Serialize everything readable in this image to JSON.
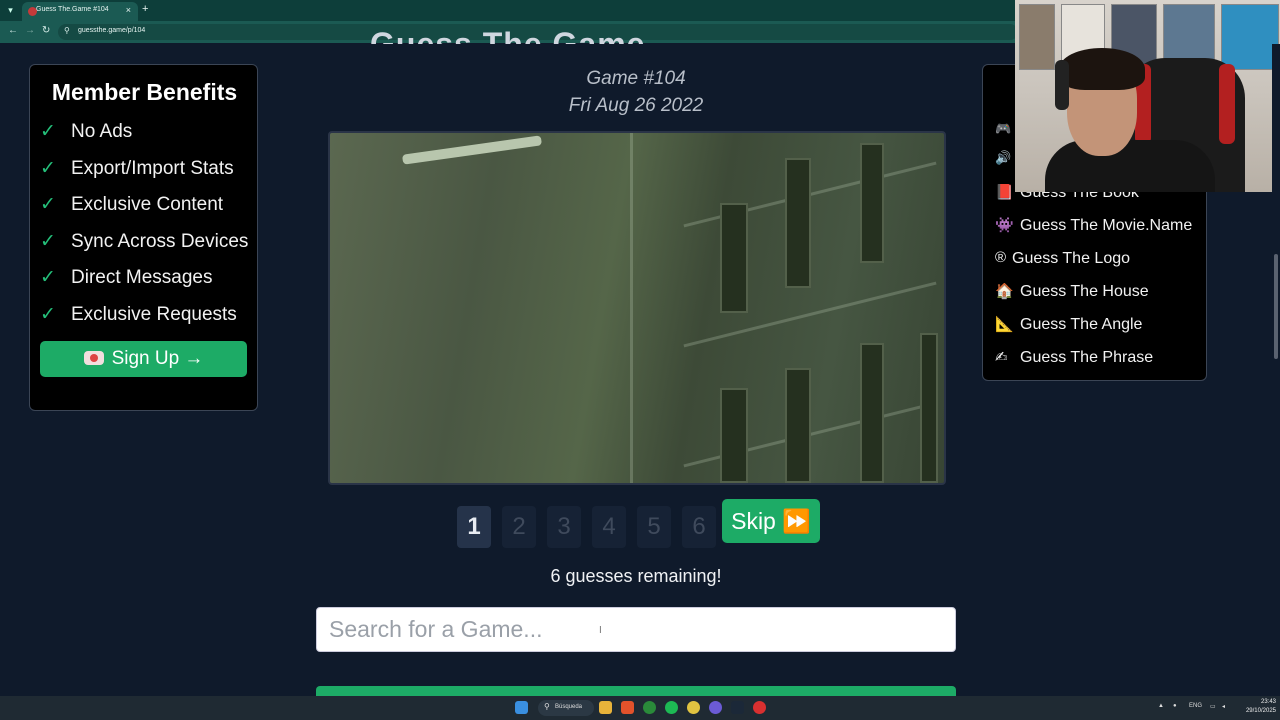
{
  "browser": {
    "tab_title": "Guess The.Game #104",
    "url": "guessthe.game/p/104"
  },
  "header": {
    "site_title": "Guess The.Game",
    "game_number": "Game #104",
    "game_date": "Fri Aug 26 2022"
  },
  "benefits": {
    "title": "Member Benefits",
    "check": "✓",
    "items": [
      "No Ads",
      "Export/Import Stats",
      "Exclusive Content",
      "Sync Across Devices",
      "Direct Messages",
      "Exclusive Requests"
    ],
    "signup_label": "Sign Up →"
  },
  "guesses": {
    "numbers": [
      "1",
      "2",
      "3",
      "4",
      "5",
      "6"
    ],
    "active": 1,
    "skip_label": "Skip ⏩",
    "remaining_text": "6 guesses remaining!"
  },
  "search": {
    "placeholder": "Search for a Game..."
  },
  "other_games": {
    "items": [
      {
        "icon": "🎮",
        "label": ""
      },
      {
        "icon": "🔊",
        "label": ""
      },
      {
        "icon": "📕",
        "label": "Guess The Book"
      },
      {
        "icon": "👾",
        "label": "Guess The Movie.Name"
      },
      {
        "icon": "®",
        "label": "Guess The Logo"
      },
      {
        "icon": "🏠",
        "label": "Guess The House"
      },
      {
        "icon": "📐",
        "label": "Guess The Angle"
      },
      {
        "icon": "✍",
        "label": "Guess The Phrase"
      }
    ]
  },
  "taskbar": {
    "search_label": "Búsqueda",
    "lang": "ENG",
    "time": "23:43",
    "date": "29/10/2025"
  },
  "colors": {
    "accent_green": "#1dab66",
    "page_bg": "#0f1a2b",
    "browser_chrome": "#1b5a53"
  }
}
